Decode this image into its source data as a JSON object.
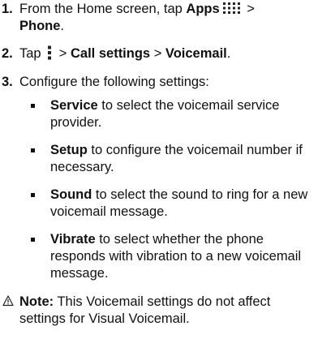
{
  "steps": [
    {
      "num": "1.",
      "pre": "From the Home screen, tap ",
      "b1": "Apps",
      "icon1": "apps-grid-icon",
      "mid": " > ",
      "b2": "Phone",
      "post": "."
    },
    {
      "num": "2.",
      "pre": "Tap ",
      "icon1": "menu-dots-icon",
      "mid": " > ",
      "b1": "Call settings",
      "sep": " > ",
      "b2": "Voicemail",
      "post": "."
    },
    {
      "num": "3.",
      "text": "Configure the following settings:"
    }
  ],
  "settings": [
    {
      "name": "Service",
      "desc": " to select the voicemail service provider."
    },
    {
      "name": "Setup",
      "desc": " to configure the voicemail number if necessary."
    },
    {
      "name": "Sound",
      "desc": " to select the sound to ring for a new voicemail message."
    },
    {
      "name": "Vibrate",
      "desc": " to select whether the phone responds with vibration to a new voicemail message."
    }
  ],
  "note": {
    "icon": "warning-icon",
    "label": "Note:",
    "text": " This Voicemail settings do not affect settings for Visual Voicemail."
  }
}
